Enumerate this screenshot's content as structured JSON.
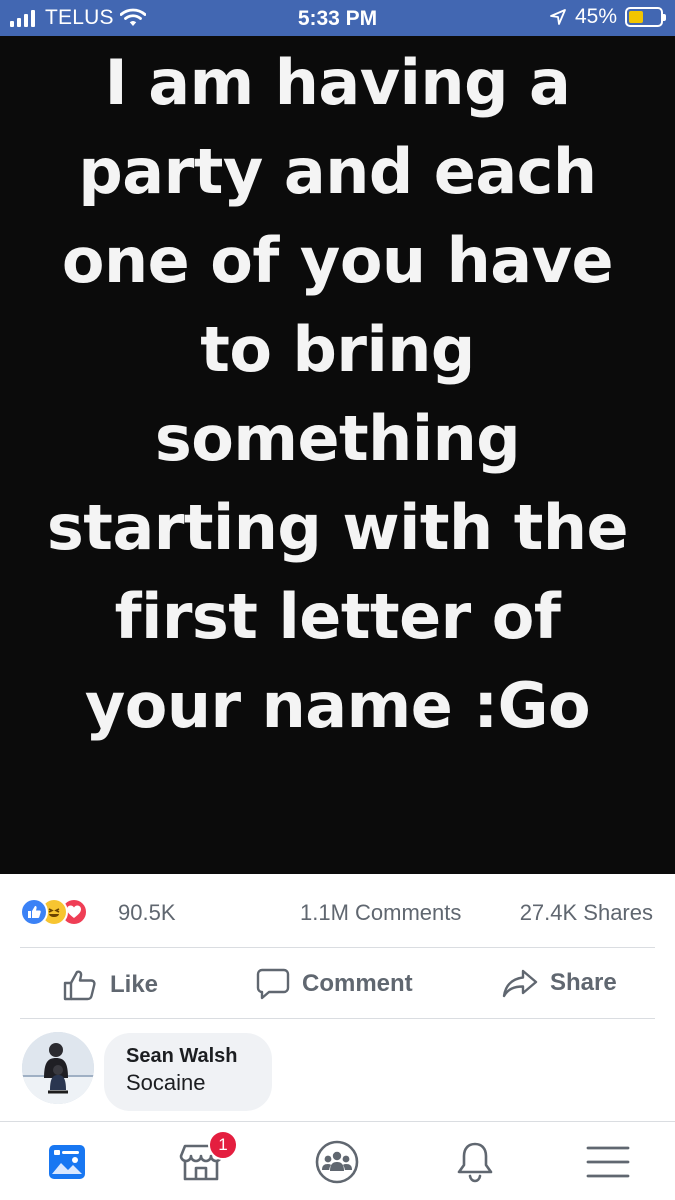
{
  "status_bar": {
    "carrier": "TELUS",
    "time": "5:33 PM",
    "battery": "45%",
    "battery_level": 0.45,
    "battery_color": "#f2c500",
    "background": "#4267b2"
  },
  "post": {
    "image_text": "I am having a party and each one of you have to bring something starting with the first letter of your name :Go"
  },
  "reactions": {
    "count": "90.5K",
    "types": [
      "like-icon",
      "haha-icon",
      "love-icon"
    ],
    "comments": "1.1M Comments",
    "shares": "27.4K Shares"
  },
  "actions": {
    "like": "Like",
    "comment": "Comment",
    "share": "Share"
  },
  "comment": {
    "author": "Sean Walsh",
    "text": "Socaine"
  },
  "tab_bar": {
    "tabs": [
      "news-feed-icon",
      "marketplace-icon",
      "groups-icon",
      "notifications-icon",
      "menu-icon"
    ],
    "marketplace_badge": "1",
    "active_color": "#1877f2"
  }
}
